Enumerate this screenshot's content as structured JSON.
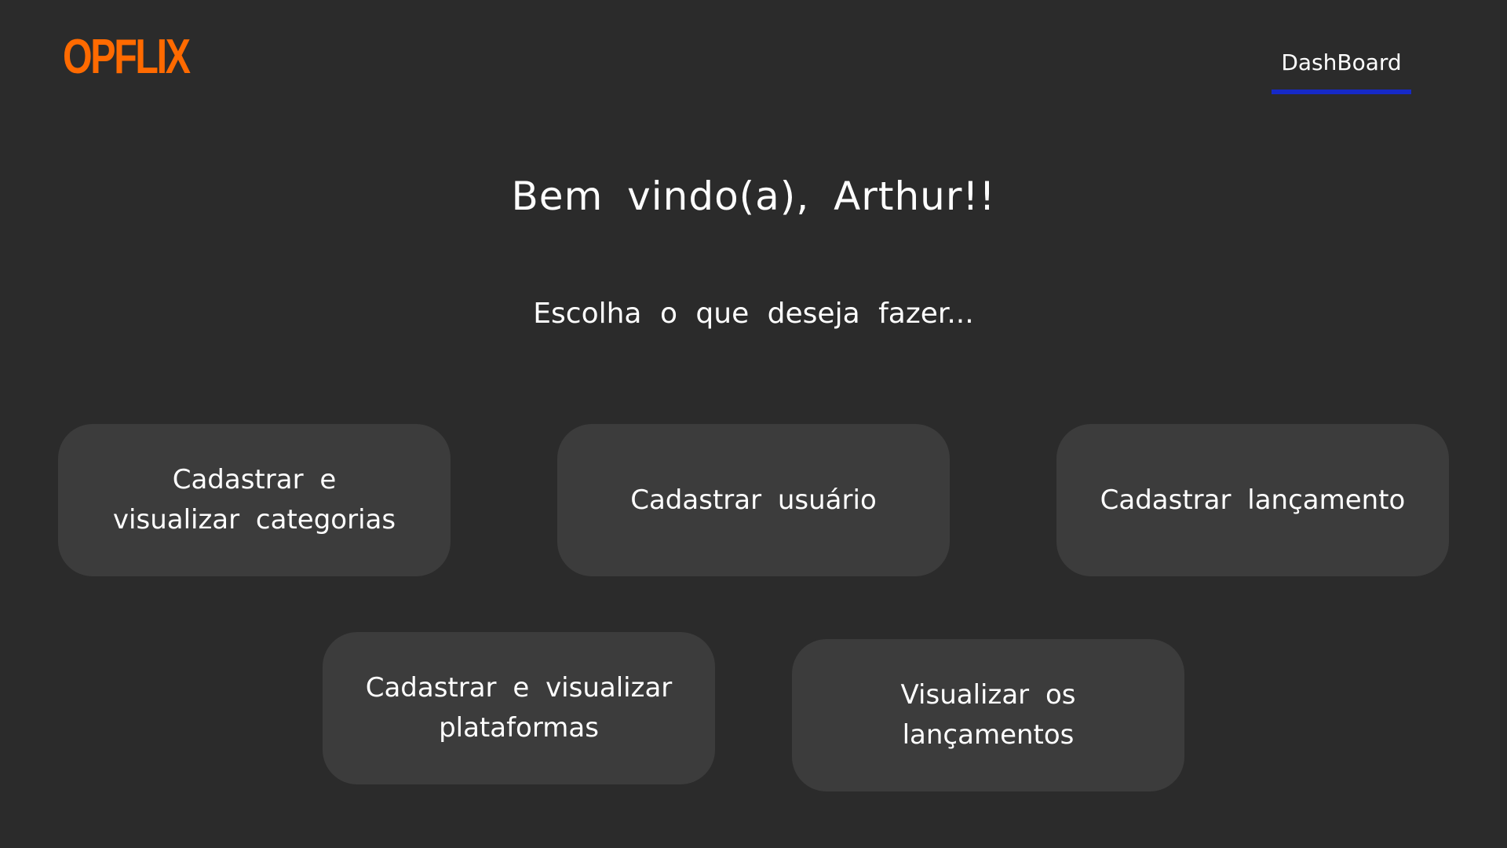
{
  "header": {
    "logo_text": "OPFLIX",
    "nav": {
      "dashboard_label": "DashBoard",
      "active_underline_color": "#1629c7"
    }
  },
  "main": {
    "welcome_text": "Bem vindo(a), Arthur!!",
    "subtitle": "Escolha o que deseja fazer...",
    "actions": [
      {
        "label": "Cadastrar e visualizar categorias"
      },
      {
        "label": "Cadastrar usuário"
      },
      {
        "label": "Cadastrar lançamento"
      },
      {
        "label": "Cadastrar e visualizar plataformas"
      },
      {
        "label": "Visualizar os lançamentos"
      }
    ]
  },
  "colors": {
    "background": "#2b2b2b",
    "card": "#3c3c3c",
    "brand": "#ff6a00",
    "text": "#ffffff"
  }
}
